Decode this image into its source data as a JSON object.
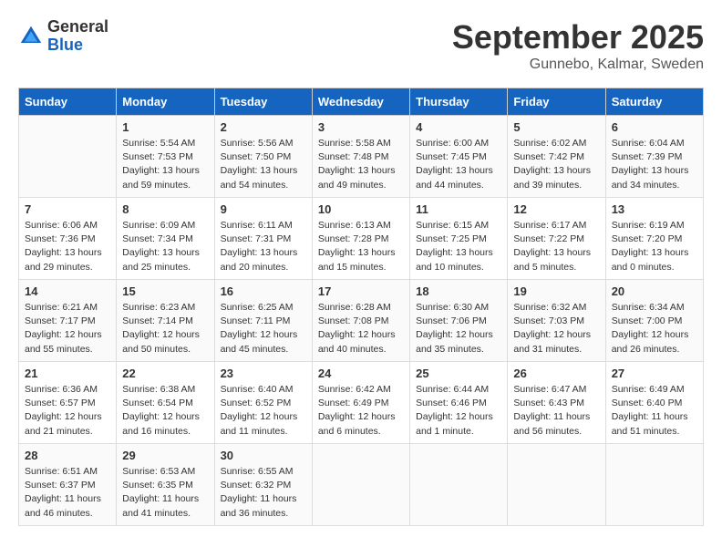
{
  "header": {
    "logo_general": "General",
    "logo_blue": "Blue",
    "month": "September 2025",
    "location": "Gunnebo, Kalmar, Sweden"
  },
  "weekdays": [
    "Sunday",
    "Monday",
    "Tuesday",
    "Wednesday",
    "Thursday",
    "Friday",
    "Saturday"
  ],
  "weeks": [
    [
      {
        "day": "",
        "info": ""
      },
      {
        "day": "1",
        "info": "Sunrise: 5:54 AM\nSunset: 7:53 PM\nDaylight: 13 hours\nand 59 minutes."
      },
      {
        "day": "2",
        "info": "Sunrise: 5:56 AM\nSunset: 7:50 PM\nDaylight: 13 hours\nand 54 minutes."
      },
      {
        "day": "3",
        "info": "Sunrise: 5:58 AM\nSunset: 7:48 PM\nDaylight: 13 hours\nand 49 minutes."
      },
      {
        "day": "4",
        "info": "Sunrise: 6:00 AM\nSunset: 7:45 PM\nDaylight: 13 hours\nand 44 minutes."
      },
      {
        "day": "5",
        "info": "Sunrise: 6:02 AM\nSunset: 7:42 PM\nDaylight: 13 hours\nand 39 minutes."
      },
      {
        "day": "6",
        "info": "Sunrise: 6:04 AM\nSunset: 7:39 PM\nDaylight: 13 hours\nand 34 minutes."
      }
    ],
    [
      {
        "day": "7",
        "info": "Sunrise: 6:06 AM\nSunset: 7:36 PM\nDaylight: 13 hours\nand 29 minutes."
      },
      {
        "day": "8",
        "info": "Sunrise: 6:09 AM\nSunset: 7:34 PM\nDaylight: 13 hours\nand 25 minutes."
      },
      {
        "day": "9",
        "info": "Sunrise: 6:11 AM\nSunset: 7:31 PM\nDaylight: 13 hours\nand 20 minutes."
      },
      {
        "day": "10",
        "info": "Sunrise: 6:13 AM\nSunset: 7:28 PM\nDaylight: 13 hours\nand 15 minutes."
      },
      {
        "day": "11",
        "info": "Sunrise: 6:15 AM\nSunset: 7:25 PM\nDaylight: 13 hours\nand 10 minutes."
      },
      {
        "day": "12",
        "info": "Sunrise: 6:17 AM\nSunset: 7:22 PM\nDaylight: 13 hours\nand 5 minutes."
      },
      {
        "day": "13",
        "info": "Sunrise: 6:19 AM\nSunset: 7:20 PM\nDaylight: 13 hours\nand 0 minutes."
      }
    ],
    [
      {
        "day": "14",
        "info": "Sunrise: 6:21 AM\nSunset: 7:17 PM\nDaylight: 12 hours\nand 55 minutes."
      },
      {
        "day": "15",
        "info": "Sunrise: 6:23 AM\nSunset: 7:14 PM\nDaylight: 12 hours\nand 50 minutes."
      },
      {
        "day": "16",
        "info": "Sunrise: 6:25 AM\nSunset: 7:11 PM\nDaylight: 12 hours\nand 45 minutes."
      },
      {
        "day": "17",
        "info": "Sunrise: 6:28 AM\nSunset: 7:08 PM\nDaylight: 12 hours\nand 40 minutes."
      },
      {
        "day": "18",
        "info": "Sunrise: 6:30 AM\nSunset: 7:06 PM\nDaylight: 12 hours\nand 35 minutes."
      },
      {
        "day": "19",
        "info": "Sunrise: 6:32 AM\nSunset: 7:03 PM\nDaylight: 12 hours\nand 31 minutes."
      },
      {
        "day": "20",
        "info": "Sunrise: 6:34 AM\nSunset: 7:00 PM\nDaylight: 12 hours\nand 26 minutes."
      }
    ],
    [
      {
        "day": "21",
        "info": "Sunrise: 6:36 AM\nSunset: 6:57 PM\nDaylight: 12 hours\nand 21 minutes."
      },
      {
        "day": "22",
        "info": "Sunrise: 6:38 AM\nSunset: 6:54 PM\nDaylight: 12 hours\nand 16 minutes."
      },
      {
        "day": "23",
        "info": "Sunrise: 6:40 AM\nSunset: 6:52 PM\nDaylight: 12 hours\nand 11 minutes."
      },
      {
        "day": "24",
        "info": "Sunrise: 6:42 AM\nSunset: 6:49 PM\nDaylight: 12 hours\nand 6 minutes."
      },
      {
        "day": "25",
        "info": "Sunrise: 6:44 AM\nSunset: 6:46 PM\nDaylight: 12 hours\nand 1 minute."
      },
      {
        "day": "26",
        "info": "Sunrise: 6:47 AM\nSunset: 6:43 PM\nDaylight: 11 hours\nand 56 minutes."
      },
      {
        "day": "27",
        "info": "Sunrise: 6:49 AM\nSunset: 6:40 PM\nDaylight: 11 hours\nand 51 minutes."
      }
    ],
    [
      {
        "day": "28",
        "info": "Sunrise: 6:51 AM\nSunset: 6:37 PM\nDaylight: 11 hours\nand 46 minutes."
      },
      {
        "day": "29",
        "info": "Sunrise: 6:53 AM\nSunset: 6:35 PM\nDaylight: 11 hours\nand 41 minutes."
      },
      {
        "day": "30",
        "info": "Sunrise: 6:55 AM\nSunset: 6:32 PM\nDaylight: 11 hours\nand 36 minutes."
      },
      {
        "day": "",
        "info": ""
      },
      {
        "day": "",
        "info": ""
      },
      {
        "day": "",
        "info": ""
      },
      {
        "day": "",
        "info": ""
      }
    ]
  ]
}
